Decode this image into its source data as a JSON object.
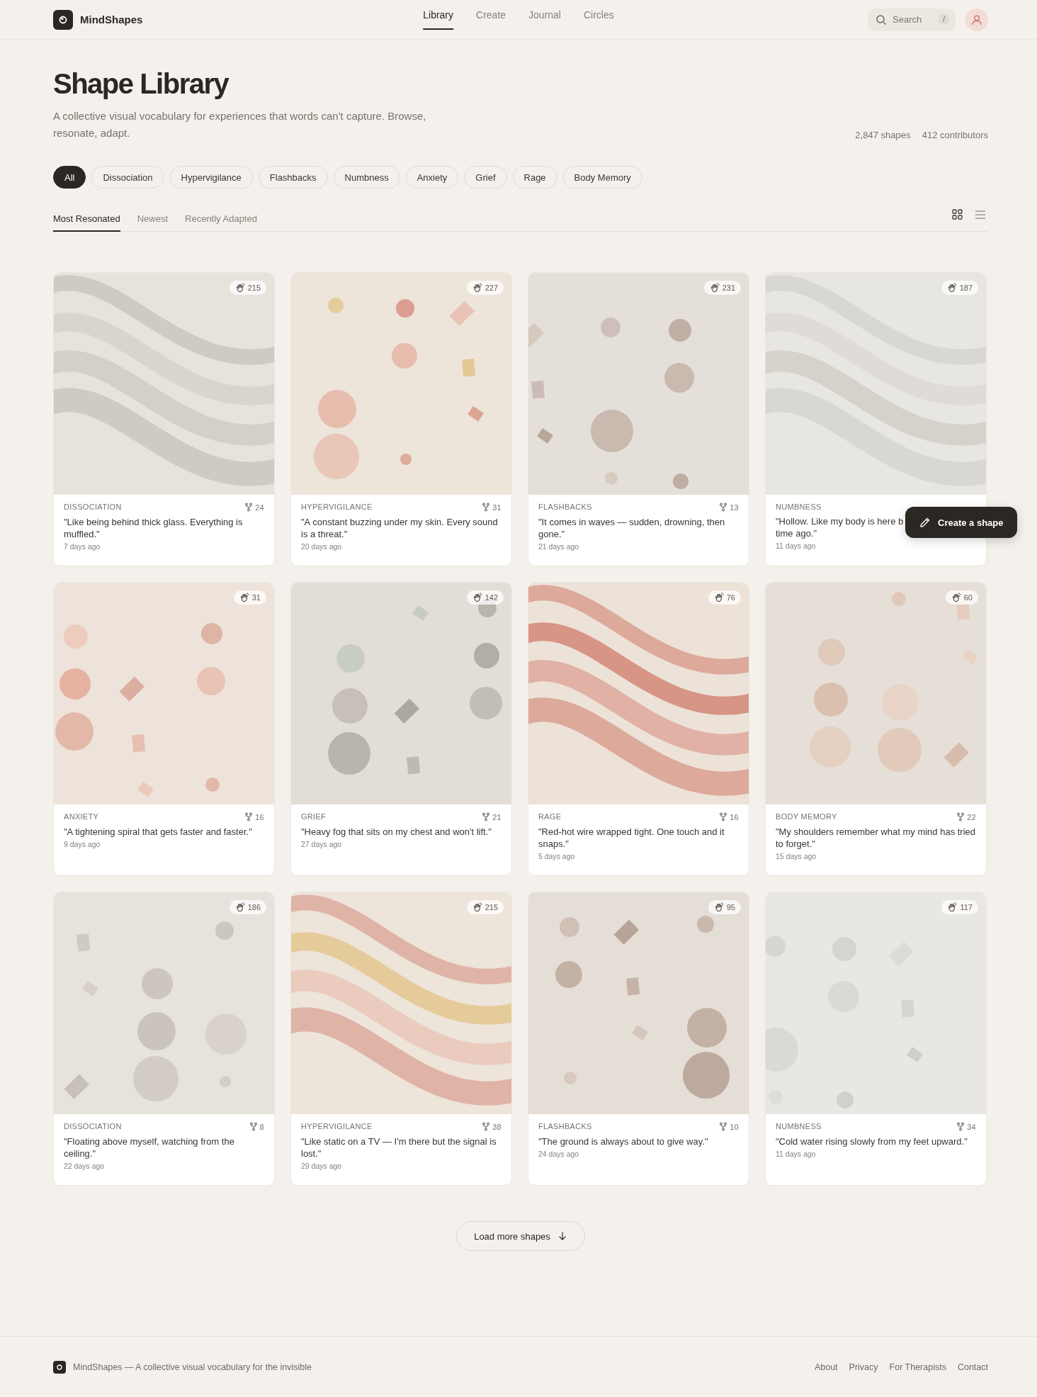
{
  "brand": {
    "name": "MindShapes"
  },
  "nav": [
    {
      "label": "Library",
      "selected": true
    },
    {
      "label": "Create",
      "selected": false
    },
    {
      "label": "Journal",
      "selected": false
    },
    {
      "label": "Circles",
      "selected": false
    }
  ],
  "search": {
    "placeholder": "Search",
    "shortcut": "/"
  },
  "page": {
    "title": "Shape Library",
    "subtitle": "A collective visual vocabulary for experiences that words can't capture. Browse, resonate, adapt.",
    "shapes_count": "2,847 shapes",
    "separator": "·",
    "contributors": "412 contributors"
  },
  "filters": [
    {
      "label": "All",
      "selected": true
    },
    {
      "label": "Dissociation",
      "selected": false
    },
    {
      "label": "Hypervigilance",
      "selected": false
    },
    {
      "label": "Flashbacks",
      "selected": false
    },
    {
      "label": "Numbness",
      "selected": false
    },
    {
      "label": "Anxiety",
      "selected": false
    },
    {
      "label": "Grief",
      "selected": false
    },
    {
      "label": "Rage",
      "selected": false
    },
    {
      "label": "Body Memory",
      "selected": false
    }
  ],
  "sort_tabs": [
    {
      "label": "Most Resonated",
      "selected": true
    },
    {
      "label": "Newest",
      "selected": false
    },
    {
      "label": "Recently Adapted",
      "selected": false
    }
  ],
  "view_toggle": [
    {
      "kind": "grid",
      "selected": true
    },
    {
      "kind": "list",
      "selected": false
    }
  ],
  "cards": [
    {
      "resonance": "215",
      "category": "DISSOCIATION",
      "adaptations": "24",
      "quote": "\"Like being behind thick glass. Everything is muffled.\"",
      "age": "7 days ago"
    },
    {
      "resonance": "227",
      "category": "HYPERVIGILANCE",
      "adaptations": "31",
      "quote": "\"A constant buzzing under my skin. Every sound is a threat.\"",
      "age": "20 days ago"
    },
    {
      "resonance": "231",
      "category": "FLASHBACKS",
      "adaptations": "13",
      "quote": "\"It comes in waves — sudden, drowning, then gone.\"",
      "age": "21 days ago"
    },
    {
      "resonance": "187",
      "category": "NUMBNESS",
      "quote_lines": [
        "\"Hollow. Like my body is here b",
        "time ago.\""
      ],
      "age": "11 days ago"
    },
    {
      "resonance": "31",
      "category": "ANXIETY",
      "adaptations": "16",
      "quote": "\"A tightening spiral that gets faster and faster.\"",
      "age": "9 days ago"
    },
    {
      "resonance": "142",
      "category": "GRIEF",
      "adaptations": "21",
      "quote": "\"Heavy fog that sits on my chest and won't lift.\"",
      "age": "27 days ago"
    },
    {
      "resonance": "76",
      "category": "RAGE",
      "adaptations": "16",
      "quote": "\"Red-hot wire wrapped tight. One touch and it snaps.\"",
      "age": "5 days ago"
    },
    {
      "resonance": "60",
      "category": "BODY MEMORY",
      "adaptations": "22",
      "quote": "\"My shoulders remember what my mind has tried to forget.\"",
      "age": "15 days ago"
    },
    {
      "resonance": "186",
      "category": "DISSOCIATION",
      "adaptations": "8",
      "quote": "\"Floating above myself, watching from the ceiling.\"",
      "age": "22 days ago"
    },
    {
      "resonance": "215",
      "category": "HYPERVIGILANCE",
      "adaptations": "38",
      "quote": "\"Like static on a TV — I'm there but the signal is lost.\"",
      "age": "29 days ago"
    },
    {
      "resonance": "95",
      "category": "FLASHBACKS",
      "adaptations": "10",
      "quote": "\"The ground is always about to give way.\"",
      "age": "24 days ago"
    },
    {
      "resonance": "117",
      "category": "NUMBNESS",
      "adaptations": "34",
      "quote": "\"Cold water rising slowly from my feet upward.\"",
      "age": "11 days ago"
    }
  ],
  "load_more": {
    "label": "Load more shapes"
  },
  "fab": {
    "label": "Create a shape"
  },
  "footer": {
    "tagline": "MindShapes — A collective visual vocabulary for the invisible",
    "links": [
      "About",
      "Privacy",
      "For Therapists",
      "Contact"
    ]
  }
}
